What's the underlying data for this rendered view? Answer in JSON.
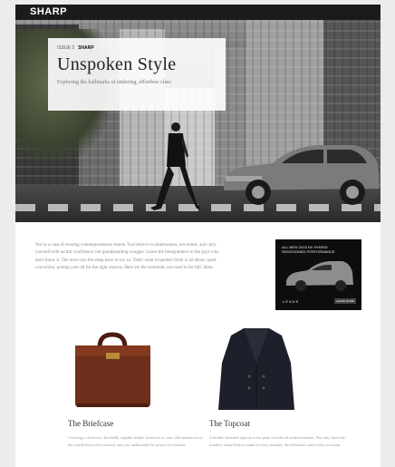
{
  "masthead": {
    "logo": "SHARP"
  },
  "hero": {
    "kicker": "ISSUE 2",
    "kicker_brand": "SHARP",
    "title": "Unspoken Style",
    "subtitle": "Exploring the hallmarks of enduring, effortless class"
  },
  "intro": {
    "text": "Not to a case of wearing contemporaneous trends. You believe in timelessness, not trends, and carry yourself with tactful confidence, not grandstanding swagger. Leave the bluegrandeur to the guys who don't know it. The ones who the sleep have to say so. That's what Unspoken Style is all about: quiet, conviction, putting your all for the right reasons. Here are the essentials you need in for fall. Shen."
  },
  "ad": {
    "headline": "ALL-NEW 2015 NX HYBRID",
    "tagline": "REDESIGNED PERFORMANCE",
    "brand": "LEXUS",
    "button": "LEARN MORE"
  },
  "products": [
    {
      "name": "The Briefcase",
      "desc": "Carrying a clean-cut, decidedly capable leather briefcase at your side announces to the world that you've arrived, and you understand the power of restraint."
    },
    {
      "name": "The Topcoat",
      "desc": "A double breasted topcoat is the peak of tailored understatement. Not only does the timeless shape help to stand in every manner, the silhouette suits every occasion."
    }
  ],
  "colors": {
    "masthead": "#1b1b1b",
    "page": "#ffffff",
    "background": "#ececec",
    "briefcase": "#6e2e1c",
    "coat": "#1d1f2a"
  }
}
